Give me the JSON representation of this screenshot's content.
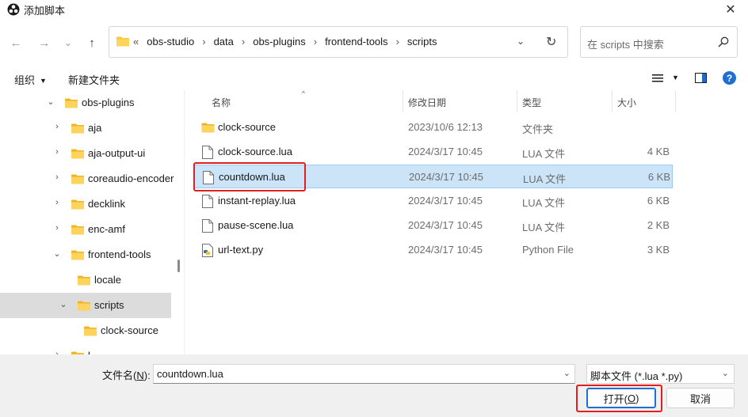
{
  "window": {
    "title": "添加脚本",
    "close_glyph": "✕"
  },
  "nav": {
    "back_glyph": "←",
    "forward_glyph": "→",
    "recent_glyph": "⌄",
    "up_glyph": "↑",
    "breadcrumb_lead": "«",
    "breadcrumbs": [
      "obs-studio",
      "data",
      "obs-plugins",
      "frontend-tools",
      "scripts"
    ],
    "separator": "›",
    "dropdown_glyph": "⌄",
    "refresh_glyph": "↻",
    "search_placeholder": "在 scripts 中搜索"
  },
  "toolbar": {
    "organize_label": "组织",
    "organize_caret": "▼",
    "new_folder_label": "新建文件夹",
    "view_caret": "▼",
    "help_glyph": "?"
  },
  "tree": {
    "items": [
      {
        "label": "obs-plugins",
        "chevron": "⌄"
      },
      {
        "label": "aja",
        "chevron": "›"
      },
      {
        "label": "aja-output-ui",
        "chevron": "›"
      },
      {
        "label": "coreaudio-encoder",
        "chevron": "›"
      },
      {
        "label": "decklink",
        "chevron": "›"
      },
      {
        "label": "enc-amf",
        "chevron": "›"
      },
      {
        "label": "frontend-tools",
        "chevron": "⌄"
      },
      {
        "label": "locale",
        "chevron": ""
      },
      {
        "label": "scripts",
        "chevron": "⌄"
      },
      {
        "label": "clock-source",
        "chevron": ""
      },
      {
        "label": "l",
        "chevron": "›"
      }
    ]
  },
  "columns": {
    "sort_glyph": "^",
    "name": "名称",
    "modified": "修改日期",
    "type": "类型",
    "size": "大小"
  },
  "files": [
    {
      "name": "clock-source",
      "modified": "2023/10/6 12:13",
      "type": "文件夹",
      "size": "",
      "icon": "folder-icon"
    },
    {
      "name": "clock-source.lua",
      "modified": "2024/3/17 10:45",
      "type": "LUA 文件",
      "size": "4 KB",
      "icon": "file-icon"
    },
    {
      "name": "countdown.lua",
      "modified": "2024/3/17 10:45",
      "type": "LUA 文件",
      "size": "6 KB",
      "icon": "file-icon"
    },
    {
      "name": "instant-replay.lua",
      "modified": "2024/3/17 10:45",
      "type": "LUA 文件",
      "size": "6 KB",
      "icon": "file-icon"
    },
    {
      "name": "pause-scene.lua",
      "modified": "2024/3/17 10:45",
      "type": "LUA 文件",
      "size": "2 KB",
      "icon": "file-icon"
    },
    {
      "name": "url-text.py",
      "modified": "2024/3/17 10:45",
      "type": "Python File",
      "size": "3 KB",
      "icon": "python-file-icon"
    }
  ],
  "footer": {
    "filename_label_pre": "文件名(",
    "filename_label_key": "N",
    "filename_label_post": "):",
    "filename_value": "countdown.lua",
    "dropdown_glyph": "⌄",
    "filetype_value": "脚本文件 (*.lua *.py)",
    "open_pre": "打开(",
    "open_key": "O",
    "open_post": ")",
    "cancel_label": "取消"
  },
  "colors": {
    "selection": "#cce4f7",
    "accent": "#1f6fd1",
    "annotation": "#e02020",
    "folder": "#f8c93a"
  }
}
